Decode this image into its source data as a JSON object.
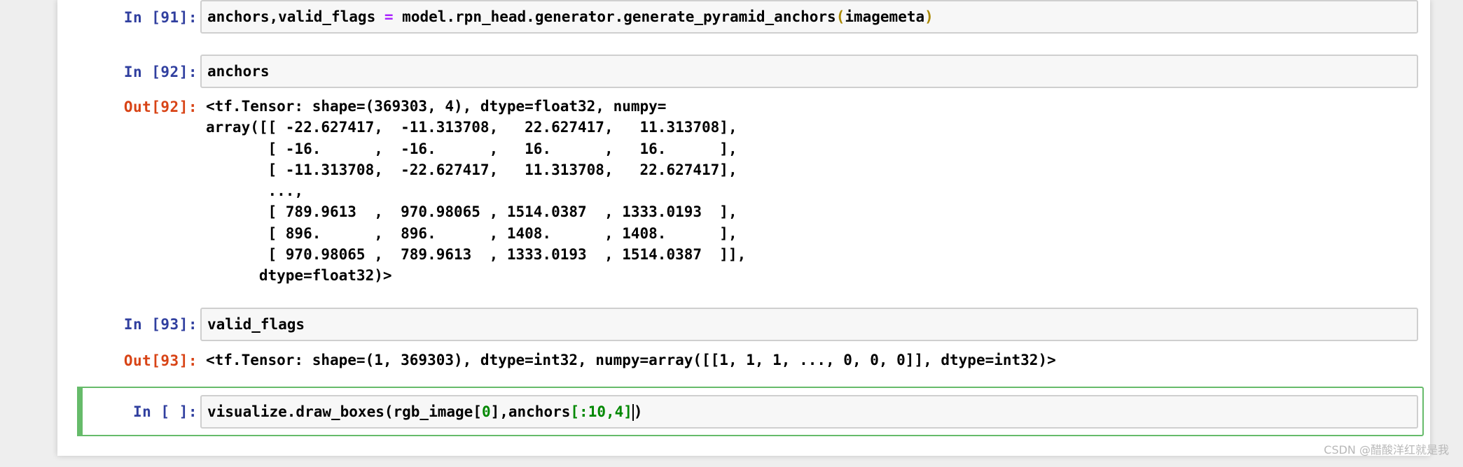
{
  "cells": [
    {
      "in_prompt": "In [91]:",
      "code_parts": {
        "a": "anchors,valid_flags ",
        "op": "=",
        "b": " model.rpn_head.generator.generate_pyramid_anchors",
        "open": "(",
        "arg": "imagemeta",
        "close": ")"
      }
    },
    {
      "in_prompt": "In [92]:",
      "code": "anchors",
      "out_prompt": "Out[92]:",
      "output": "<tf.Tensor: shape=(369303, 4), dtype=float32, numpy=\narray([[ -22.627417,  -11.313708,   22.627417,   11.313708],\n       [ -16.      ,  -16.      ,   16.      ,   16.      ],\n       [ -11.313708,  -22.627417,   11.313708,   22.627417],\n       ...,\n       [ 789.9613  ,  970.98065 , 1514.0387  , 1333.0193  ],\n       [ 896.      ,  896.      , 1408.      , 1408.      ],\n       [ 970.98065 ,  789.9613  , 1333.0193  , 1514.0387  ]],\n      dtype=float32)>"
    },
    {
      "in_prompt": "In [93]:",
      "code": "valid_flags",
      "out_prompt": "Out[93]:",
      "output": "<tf.Tensor: shape=(1, 369303), dtype=int32, numpy=array([[1, 1, 1, ..., 0, 0, 0]], dtype=int32)>"
    },
    {
      "in_prompt": "In [ ]:",
      "code_parts": {
        "a": "visualize.draw_boxes(rgb_image[",
        "n0": "0",
        "b": "],anchors",
        "br_open": "[",
        "slice": ":10,4",
        "br_close": "]",
        "close": ")"
      }
    }
  ],
  "watermark": "CSDN @醋酸洋红就是我",
  "colors": {
    "in_prompt": "#303f9f",
    "out_prompt": "#d84315",
    "selected_border": "#66bb6a",
    "operator": "#aa22ff",
    "number": "#008800"
  }
}
